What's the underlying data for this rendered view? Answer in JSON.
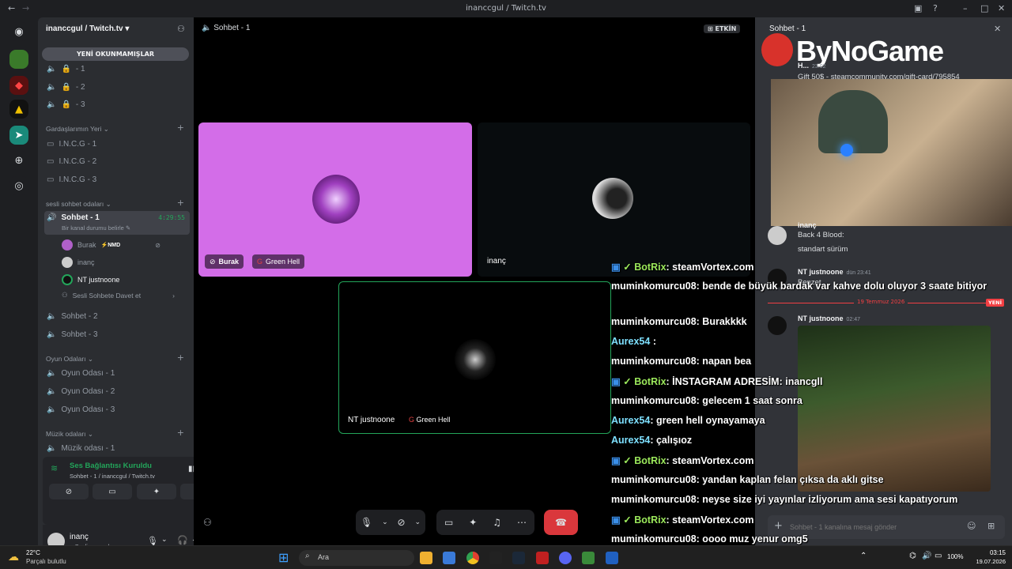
{
  "window": {
    "title": "inanccgul / Twitch.tv"
  },
  "server": {
    "name": "inanccgul / Twitch.tv",
    "unread_label": "YENİ OKUNMAMIŞLAR"
  },
  "locked_channels": [
    "- 1",
    "- 2",
    "- 3"
  ],
  "categories": {
    "gardas": "Gardaşlarımın Yeri",
    "sesli": "sesli sohbet odaları",
    "oyun": "Oyun Odaları",
    "muzik": "Müzik odaları"
  },
  "text_channels": [
    "I.N.C.G - 1",
    "I.N.C.G - 2",
    "I.N.C.G - 3"
  ],
  "voice": {
    "active_channel": "Sohbet - 1",
    "active_timer": "4:29:55",
    "status_hint": "Bir kanal durumu belirle",
    "members": [
      {
        "name": "Burak",
        "badge": "NMD"
      },
      {
        "name": "inanç"
      },
      {
        "name": "NT justnoone"
      }
    ],
    "invite_label": "Sesli Sohbete Davet et",
    "others": [
      "Sohbet - 2",
      "Sohbet - 3"
    ],
    "game_rooms": [
      "Oyun Odası - 1",
      "Oyun Odası - 2",
      "Oyun Odası - 3"
    ],
    "music_rooms": [
      "Müzik odası - 1"
    ]
  },
  "connection": {
    "status": "Ses Bağlantısı Kuruldu",
    "detail": "Sohbet - 1 / inanccgul / Twitch.tv"
  },
  "user": {
    "name": "inanç",
    "status": "Sesli aramada"
  },
  "call": {
    "header": "Sohbet - 1",
    "activity_badge": "ETKİN",
    "tiles": [
      {
        "name": "Burak",
        "activity": "Green Hell"
      },
      {
        "name": "inanç"
      },
      {
        "name": "NT justnoone",
        "activity": "Green Hell"
      }
    ]
  },
  "overlay": {
    "brand": "ByNoGame",
    "chat": [
      {
        "user": "BotRix",
        "text": ": steamVortex.com",
        "kind": "bot"
      },
      {
        "user": "muminkomurcu08",
        "text": ": bende de büyük bardak var kahve dolu oluyor 3 saate bitiyor",
        "kind": "user"
      },
      {
        "user": "muminkomurcu08",
        "text": ": Burakkkk",
        "kind": "user"
      },
      {
        "user": "Aurex54",
        "text": " :",
        "kind": "aurex"
      },
      {
        "user": "muminkomurcu08",
        "text": ": napan bea",
        "kind": "user"
      },
      {
        "user": "BotRix",
        "text": ": İNSTAGRAM ADRESİM: inancgll",
        "kind": "bot"
      },
      {
        "user": "muminkomurcu08",
        "text": ": gelecem 1 saat sonra",
        "kind": "user"
      },
      {
        "user": "Aurex54",
        "text": ": green hell oynayamaya",
        "kind": "aurex"
      },
      {
        "user": "Aurex54",
        "text": ": çalışıoz",
        "kind": "aurex"
      },
      {
        "user": "BotRix",
        "text": ": steamVortex.com",
        "kind": "bot"
      },
      {
        "user": "muminkomurcu08",
        "text": ": yandan kaplan felan çıksa da aklı gitse",
        "kind": "user"
      },
      {
        "user": "muminkomurcu08",
        "text": ": neyse size iyi yayınlar izliyorum ama sesi kapatıyorum",
        "kind": "user"
      },
      {
        "user": "BotRix",
        "text": ": steamVortex.com",
        "kind": "bot"
      },
      {
        "user": "muminkomurcu08",
        "text": ": oooo muz yenur omg5",
        "kind": "user"
      },
      {
        "user": "BotRix",
        "text": ": İNSTAGRAM ADRESİM: inancgll",
        "kind": "bot"
      }
    ]
  },
  "side_chat": {
    "header": "Sohbet - 1",
    "top_msg": {
      "name": "H...",
      "time": "23:02",
      "text": "Gift 50$ - steamcommunity.com/gift-card/795854"
    },
    "messages": [
      {
        "name": "inanç",
        "lines": [
          "Back 4 Blood:",
          "standart sürüm"
        ]
      },
      {
        "name": "NT justnoone",
        "time": "dün 23:41",
        "text": "Benzet"
      }
    ],
    "divider": "19 Temmuz 2026",
    "new_label": "YENİ",
    "last": {
      "name": "NT justnoone",
      "time": "02:47"
    },
    "input_placeholder": "Sohbet - 1 kanalına mesaj gönder"
  },
  "taskbar": {
    "weather_temp": "22°C",
    "weather_desc": "Parçalı bulutlu",
    "search_placeholder": "Ara",
    "battery": "100%",
    "time": "03:15",
    "date": "19.07.2026"
  }
}
